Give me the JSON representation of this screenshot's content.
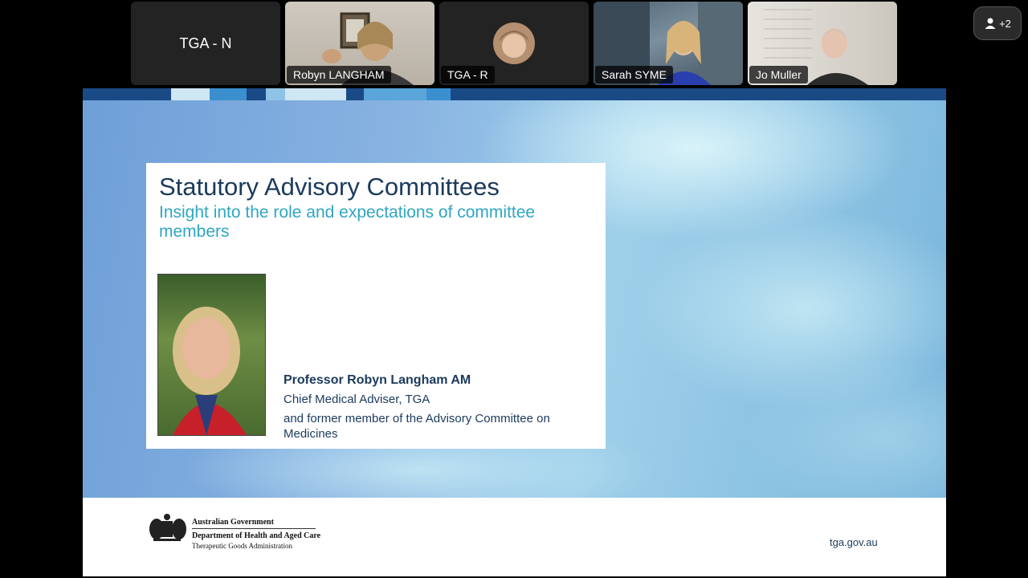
{
  "participants": [
    {
      "id": "tga-n",
      "center_label": "TGA - N",
      "name": ""
    },
    {
      "id": "robyn",
      "center_label": "",
      "name": "Robyn LANGHAM"
    },
    {
      "id": "tga-r",
      "center_label": "",
      "name": "TGA - R"
    },
    {
      "id": "sarah",
      "center_label": "",
      "name": "Sarah SYME"
    },
    {
      "id": "jo",
      "center_label": "",
      "name": "Jo Muller"
    }
  ],
  "toolbar": {
    "extra_participants": "+2",
    "people_icon": "person-icon"
  },
  "slide": {
    "title": "Statutory Advisory Committees",
    "subtitle": "Insight into the role and expectations of committee members",
    "speaker_name": "Professor Robyn Langham AM",
    "speaker_role": "Chief Medical Adviser, TGA",
    "speaker_former": "and former member of the Advisory Committee on Medicines",
    "footer": {
      "gov_line1": "Australian Government",
      "gov_line2": "Department of Health and Aged Care",
      "gov_line3": "Therapeutic Goods Administration",
      "url": "tga.gov.au"
    },
    "colors": {
      "brand_navy": "#1b3a5c",
      "accent_teal": "#2fa6c0",
      "top_bar": "#1a4a86"
    }
  }
}
